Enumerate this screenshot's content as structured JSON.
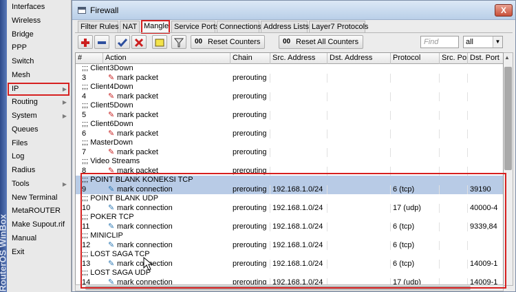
{
  "sidebar": {
    "brand": "RouterOS WinBox",
    "items": [
      {
        "label": "Interfaces",
        "submenu": false
      },
      {
        "label": "Wireless",
        "submenu": false
      },
      {
        "label": "Bridge",
        "submenu": false
      },
      {
        "label": "PPP",
        "submenu": false
      },
      {
        "label": "Switch",
        "submenu": false
      },
      {
        "label": "Mesh",
        "submenu": false
      },
      {
        "label": "IP",
        "submenu": true,
        "highlighted": true
      },
      {
        "label": "Routing",
        "submenu": true
      },
      {
        "label": "System",
        "submenu": true
      },
      {
        "label": "Queues",
        "submenu": false
      },
      {
        "label": "Files",
        "submenu": false
      },
      {
        "label": "Log",
        "submenu": false
      },
      {
        "label": "Radius",
        "submenu": false
      },
      {
        "label": "Tools",
        "submenu": true
      },
      {
        "label": "New Terminal",
        "submenu": false
      },
      {
        "label": "MetaROUTER",
        "submenu": false
      },
      {
        "label": "Make Supout.rif",
        "submenu": false
      },
      {
        "label": "Manual",
        "submenu": false
      },
      {
        "label": "Exit",
        "submenu": false
      }
    ]
  },
  "window": {
    "title": "Firewall",
    "close_label": "X",
    "tabs": [
      "Filter Rules",
      "NAT",
      "Mangle",
      "Service Ports",
      "Connections",
      "Address Lists",
      "Layer7 Protocols"
    ],
    "active_tab": "Mangle"
  },
  "toolbar": {
    "add_icon": "plus-icon",
    "remove_icon": "minus-icon",
    "enable_icon": "check-icon",
    "disable_icon": "x-icon",
    "comment_icon": "note-icon",
    "filter_icon": "funnel-icon",
    "reset_counters": "Reset Counters",
    "reset_all_counters": "Reset All Counters",
    "counter_glyph": "00",
    "find_placeholder": "Find",
    "filter_select": "all"
  },
  "table": {
    "columns": [
      "#",
      "Action",
      "Chain",
      "Src. Address",
      "Dst. Address",
      "Protocol",
      "Src. Port",
      "Dst. Port"
    ],
    "rows": [
      {
        "kind": "comment",
        "text": ";;; Client3Down"
      },
      {
        "kind": "rule",
        "num": "3",
        "action": "mark packet",
        "icon": "red",
        "chain": "prerouting",
        "src": "",
        "dst": "",
        "proto": "",
        "sport": "",
        "dport": ""
      },
      {
        "kind": "comment",
        "text": ";;; Client4Down"
      },
      {
        "kind": "rule",
        "num": "4",
        "action": "mark packet",
        "icon": "red",
        "chain": "prerouting",
        "src": "",
        "dst": "",
        "proto": "",
        "sport": "",
        "dport": ""
      },
      {
        "kind": "comment",
        "text": ";;; Client5Down"
      },
      {
        "kind": "rule",
        "num": "5",
        "action": "mark packet",
        "icon": "red",
        "chain": "prerouting",
        "src": "",
        "dst": "",
        "proto": "",
        "sport": "",
        "dport": ""
      },
      {
        "kind": "comment",
        "text": ";;; Client6Down"
      },
      {
        "kind": "rule",
        "num": "6",
        "action": "mark packet",
        "icon": "red",
        "chain": "prerouting",
        "src": "",
        "dst": "",
        "proto": "",
        "sport": "",
        "dport": ""
      },
      {
        "kind": "comment",
        "text": ";;; MasterDown"
      },
      {
        "kind": "rule",
        "num": "7",
        "action": "mark packet",
        "icon": "red",
        "chain": "prerouting",
        "src": "",
        "dst": "",
        "proto": "",
        "sport": "",
        "dport": ""
      },
      {
        "kind": "comment",
        "text": ";;; Video Streams"
      },
      {
        "kind": "rule",
        "num": "8",
        "action": "mark packet",
        "icon": "red",
        "chain": "prerouting",
        "src": "",
        "dst": "",
        "proto": "",
        "sport": "",
        "dport": ""
      },
      {
        "kind": "comment",
        "text": ";;; POINT BLANK KONEKSI TCP",
        "selected": true
      },
      {
        "kind": "rule",
        "num": "9",
        "action": "mark connection",
        "icon": "blue",
        "chain": "prerouting",
        "src": "192.168.1.0/24",
        "dst": "",
        "proto": "6 (tcp)",
        "sport": "",
        "dport": "39190",
        "selected": true
      },
      {
        "kind": "comment",
        "text": ";;; POINT BLANK UDP"
      },
      {
        "kind": "rule",
        "num": "10",
        "action": "mark connection",
        "icon": "blue",
        "chain": "prerouting",
        "src": "192.168.1.0/24",
        "dst": "",
        "proto": "17 (udp)",
        "sport": "",
        "dport": "40000-4"
      },
      {
        "kind": "comment",
        "text": ";;; POKER TCP"
      },
      {
        "kind": "rule",
        "num": "11",
        "action": "mark connection",
        "icon": "blue",
        "chain": "prerouting",
        "src": "192.168.1.0/24",
        "dst": "",
        "proto": "6 (tcp)",
        "sport": "",
        "dport": "9339,84"
      },
      {
        "kind": "comment",
        "text": ";;; MINICLIP"
      },
      {
        "kind": "rule",
        "num": "12",
        "action": "mark connection",
        "icon": "blue",
        "chain": "prerouting",
        "src": "192.168.1.0/24",
        "dst": "",
        "proto": "6 (tcp)",
        "sport": "",
        "dport": ""
      },
      {
        "kind": "comment",
        "text": ";;; LOST SAGA TCP"
      },
      {
        "kind": "rule",
        "num": "13",
        "action": "mark connection",
        "icon": "blue",
        "chain": "prerouting",
        "src": "192.168.1.0/24",
        "dst": "",
        "proto": "6 (tcp)",
        "sport": "",
        "dport": "14009-1"
      },
      {
        "kind": "comment",
        "text": ";;; LOST SAGA UDP"
      },
      {
        "kind": "rule",
        "num": "14",
        "action": "mark connection",
        "icon": "blue",
        "chain": "prerouting",
        "src": "192.168.1.0/24",
        "dst": "",
        "proto": "17 (udp)",
        "sport": "",
        "dport": "14009-1"
      }
    ]
  },
  "colors": {
    "highlight": "#d61f1f",
    "selected_row": "#b8cbe6",
    "mark_packet_icon": "#c61d1d",
    "mark_connection_icon": "#2c78b3"
  }
}
